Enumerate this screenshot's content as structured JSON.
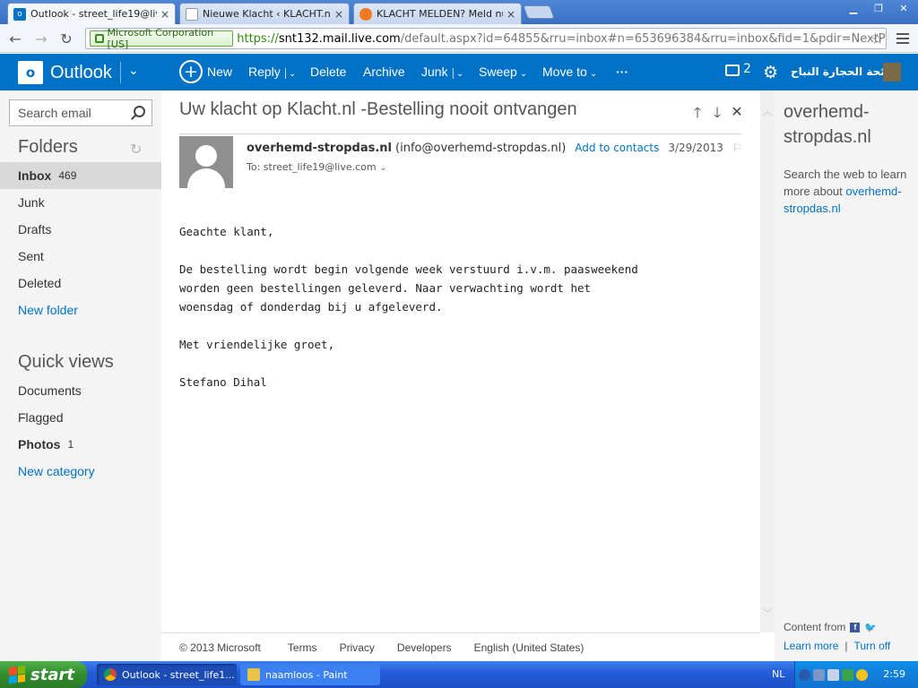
{
  "browser": {
    "tabs": [
      {
        "title": "Outlook - street_life19@live.",
        "icon": "outlook-favicon"
      },
      {
        "title": "Nieuwe Klacht ‹ KLACHT.nl —",
        "icon": "page-icon"
      },
      {
        "title": "KLACHT MELDEN? Meld nu u",
        "icon": "klacht-favicon"
      }
    ],
    "ev_label": "Microsoft Corporation [US]",
    "url_scheme": "https://",
    "url_host": "snt132.mail.live.com",
    "url_path": "/default.aspx?id=64855&rru=inbox#n=653696384&rru=inbox&fid=1&pdir=NextPage&p"
  },
  "header": {
    "app_name": "Outlook",
    "logo_letter": "o",
    "commands": {
      "new": "New",
      "reply": "Reply",
      "delete": "Delete",
      "archive": "Archive",
      "junk": "Junk",
      "sweep": "Sweep",
      "move_to": "Move to",
      "more": "···"
    },
    "messages_count": "2",
    "user_name": "رائحة الحجارة النباح"
  },
  "sidebar": {
    "search_placeholder": "Search email",
    "folders_title": "Folders",
    "folders": [
      {
        "label": "Inbox",
        "count": "469"
      },
      {
        "label": "Junk"
      },
      {
        "label": "Drafts"
      },
      {
        "label": "Sent"
      },
      {
        "label": "Deleted"
      }
    ],
    "new_folder": "New folder",
    "quick_views_title": "Quick views",
    "quick_views": [
      {
        "label": "Documents"
      },
      {
        "label": "Flagged"
      },
      {
        "label": "Photos",
        "count": "1"
      }
    ],
    "new_category": "New category"
  },
  "message": {
    "subject": "Uw klacht op Klacht.nl -Bestelling nooit ontvangen",
    "sender_name": "overhemd-stropdas.nl",
    "sender_email": "(info@overhemd-stropdas.nl)",
    "add_contacts": "Add to contacts",
    "date": "3/29/2013",
    "to": "To: street_life19@live.com",
    "body": "Geachte klant,\n\nDe bestelling wordt begin volgende week verstuurd i.v.m. paasweekend\nworden geen bestellingen geleverd. Naar verwachting wordt het\nwoensdag of donderdag bij u afgeleverd.\n\nMet vriendelijke groet,\n\nStefano Dihal"
  },
  "rightpane": {
    "title": "overhemd-stropdas.nl",
    "desc": "Search the web to learn more about",
    "link": "overhemd-stropdas.nl",
    "content_from": "Content from",
    "learn_more": "Learn more",
    "separator": "|",
    "turn_off": "Turn off"
  },
  "footer": {
    "copyright": "© 2013 Microsoft",
    "terms": "Terms",
    "privacy": "Privacy",
    "developers": "Developers",
    "language": "English (United States)"
  },
  "taskbar": {
    "start": "start",
    "tasks": [
      {
        "label": "Outlook - street_life1..."
      },
      {
        "label": "naamloos - Paint"
      }
    ],
    "lang": "NL",
    "time": "2:59"
  },
  "colors": {
    "accent": "#0072c6",
    "xp_taskbar": "#245edb",
    "xp_start": "#318c2d"
  }
}
